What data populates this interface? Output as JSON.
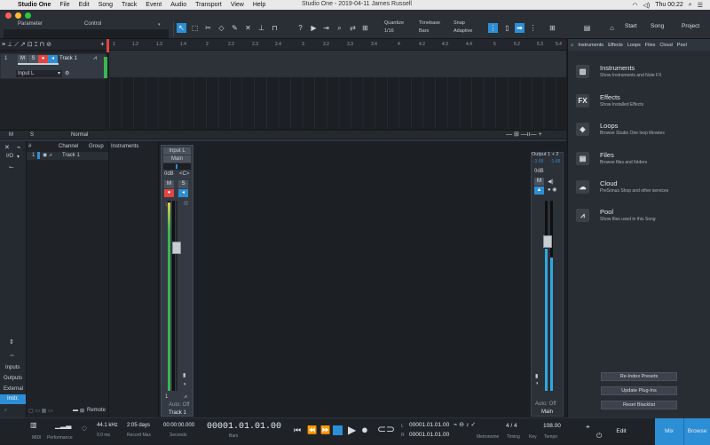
{
  "menubar": {
    "apple_icon": "apple-icon",
    "app_name": "Studio One",
    "items": [
      "File",
      "Edit",
      "Song",
      "Track",
      "Event",
      "Audio",
      "Transport",
      "View",
      "Help"
    ],
    "window_title": "Studio One - 2019-04-11 James Russell",
    "clock": "Thu 00:22"
  },
  "toolbar": {
    "parameter_label": "Parameter",
    "control_label": "Control",
    "quantize_label": "Quantize",
    "quantize_value": "1/16",
    "timebase_label": "Timebase",
    "timebase_value": "Bars",
    "snap_label": "Snap",
    "snap_value": "Adaptive",
    "start_label": "Start",
    "song_label": "Song",
    "project_label": "Project"
  },
  "ruler": {
    "marks": [
      "1",
      "1.2",
      "1.3",
      "1.4",
      "2",
      "2.2",
      "2.3",
      "2.4",
      "3",
      "3.2",
      "3.3",
      "3.4",
      "4",
      "4.2",
      "4.3",
      "4.4",
      "5",
      "5.2",
      "5.3",
      "5.4"
    ]
  },
  "track": {
    "number": "1",
    "m": "M",
    "s": "S",
    "name": "Track 1",
    "input": "Input L"
  },
  "arrange_footer": {
    "m": "M",
    "s": "S",
    "mode": "Normal"
  },
  "console": {
    "left_buttons": [
      "I/O"
    ],
    "side_labels": [
      "Inputs",
      "Outputs",
      "External",
      "Instr."
    ],
    "channel_header": [
      "#",
      "Channel",
      "Group"
    ],
    "channel_row": {
      "number": "1",
      "name": "Track 1"
    },
    "instruments_label": "Instruments",
    "remote_label": "Remote",
    "strip": {
      "input": "Input L",
      "output": "Main",
      "level": "0dB",
      "pan": "<C>",
      "m": "M",
      "s": "S",
      "number": "1",
      "auto": "Auto: Off",
      "name": "Track 1",
      "scale": [
        "0",
        "-6",
        "-12",
        "-18",
        "-24",
        "-30",
        "-36",
        "-42",
        "-48",
        "-54",
        "-60",
        "-66",
        "-72"
      ]
    },
    "main_strip": {
      "output": "Output 1 + 2",
      "peak_l": "-1.65",
      "peak_r": "-1.65",
      "level": "0dB",
      "m": "M",
      "auto": "Auto: Off",
      "name": "Main"
    }
  },
  "browser": {
    "tabs": [
      "Instruments",
      "Effects",
      "Loops",
      "Files",
      "Cloud",
      "Pool"
    ],
    "items": [
      {
        "title": "Instruments",
        "sub": "Show Instruments and Note FX",
        "icon": "piano-icon"
      },
      {
        "title": "Effects",
        "sub": "Show Installed Effects",
        "icon": "fx-icon"
      },
      {
        "title": "Loops",
        "sub": "Browse Studio One loop libraries",
        "icon": "shield-icon"
      },
      {
        "title": "Files",
        "sub": "Browse files and folders",
        "icon": "folder-icon"
      },
      {
        "title": "Cloud",
        "sub": "PreSonus Shop and other services",
        "icon": "cloud-icon"
      },
      {
        "title": "Pool",
        "sub": "Show files used in this Song",
        "icon": "waveform-icon"
      }
    ],
    "buttons": [
      "Re-Index Presets",
      "Update Plug-Ins",
      "Reset Blacklist"
    ]
  },
  "transport": {
    "midi_label": "MIDI",
    "performance_label": "Performance",
    "sample_rate": "44.1 kHz",
    "latency": "0.0 ms",
    "record_max_value": "2:05 days",
    "record_max_label": "Record Max",
    "seconds_value": "00:00:00.000",
    "seconds_label": "Seconds",
    "bars_value": "00001.01.01.00",
    "bars_label": "Bars",
    "loop_l": "00001.01.01.00",
    "loop_r": "00001.01.01.00",
    "l_label": "L",
    "r_label": "R",
    "metronome_label": "Metronome",
    "timing_value": "4 / 4",
    "timing_label": "Timing",
    "key_label": "Key",
    "tempo_value": "108.00",
    "tempo_label": "Tempo",
    "edit_tab": "Edit",
    "mix_tab": "Mix",
    "browse_tab": "Browse"
  },
  "colors": {
    "accent": "#2c8fd6",
    "record": "#e0453f",
    "meter_green": "#3bb64f"
  }
}
